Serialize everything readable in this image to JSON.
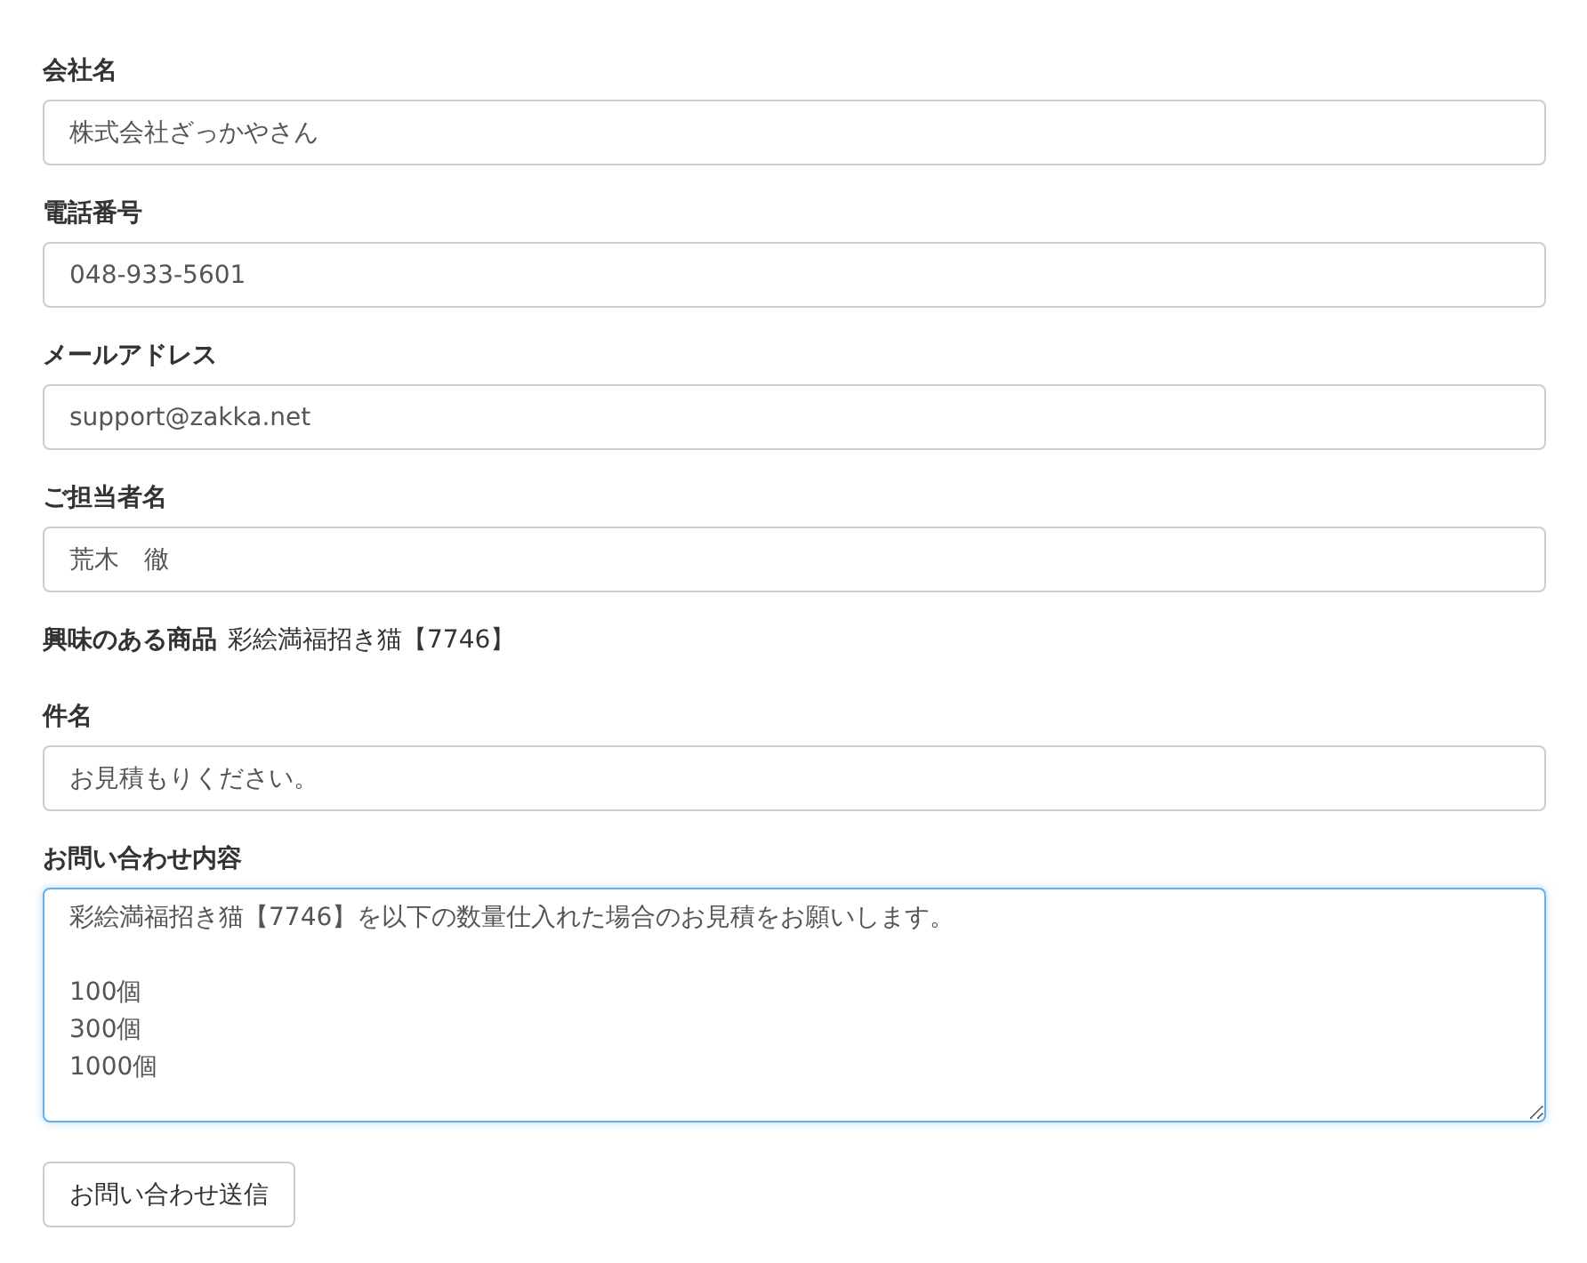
{
  "fields": [
    {
      "kind": "input",
      "label": "会社名",
      "value": "株式会社ざっかやさん"
    },
    {
      "kind": "input",
      "label": "電話番号",
      "value": "048-933-5601"
    },
    {
      "kind": "input",
      "label": "メールアドレス",
      "value": "support@zakka.net"
    },
    {
      "kind": "input",
      "label": "ご担当者名",
      "value": "荒木　徹"
    },
    {
      "kind": "info",
      "label": "興味のある商品",
      "value": "彩絵満福招き猫【7746】"
    },
    {
      "kind": "input",
      "label": "件名",
      "value": "お見積もりください。"
    },
    {
      "kind": "textarea",
      "label": "お問い合わせ内容",
      "value": "彩絵満福招き猫【7746】を以下の数量仕入れた場合のお見積をお願いします。\n\n100個\n300個\n1000個",
      "focused": true
    }
  ],
  "submit": {
    "label": "お問い合わせ送信"
  }
}
